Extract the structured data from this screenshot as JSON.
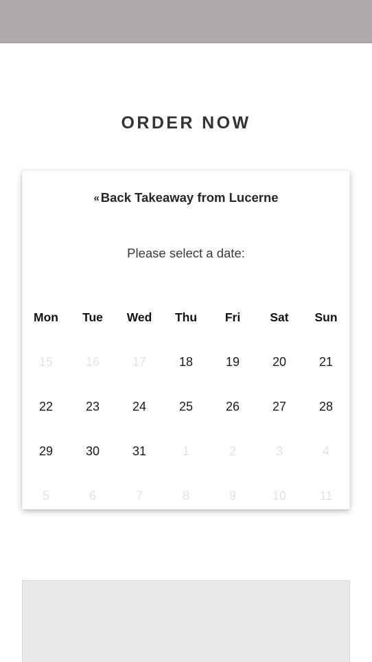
{
  "topbar": {},
  "page": {
    "title": "ORDER NOW"
  },
  "card": {
    "back_chevron": "«",
    "back_label": "Back Takeaway from Lucerne",
    "subtitle": "Please select a date:"
  },
  "calendar": {
    "weekdays": [
      "Mon",
      "Tue",
      "Wed",
      "Thu",
      "Fri",
      "Sat",
      "Sun"
    ],
    "weeks": [
      [
        {
          "day": "15",
          "enabled": false
        },
        {
          "day": "16",
          "enabled": false
        },
        {
          "day": "17",
          "enabled": false
        },
        {
          "day": "18",
          "enabled": true
        },
        {
          "day": "19",
          "enabled": true
        },
        {
          "day": "20",
          "enabled": true
        },
        {
          "day": "21",
          "enabled": true
        }
      ],
      [
        {
          "day": "22",
          "enabled": true
        },
        {
          "day": "23",
          "enabled": true
        },
        {
          "day": "24",
          "enabled": true
        },
        {
          "day": "25",
          "enabled": true
        },
        {
          "day": "26",
          "enabled": true
        },
        {
          "day": "27",
          "enabled": true
        },
        {
          "day": "28",
          "enabled": true
        }
      ],
      [
        {
          "day": "29",
          "enabled": true
        },
        {
          "day": "30",
          "enabled": true
        },
        {
          "day": "31",
          "enabled": true
        },
        {
          "day": "1",
          "enabled": false
        },
        {
          "day": "2",
          "enabled": false
        },
        {
          "day": "3",
          "enabled": false
        },
        {
          "day": "4",
          "enabled": false
        }
      ],
      [
        {
          "day": "5",
          "enabled": false
        },
        {
          "day": "6",
          "enabled": false
        },
        {
          "day": "7",
          "enabled": false
        },
        {
          "day": "8",
          "enabled": false
        },
        {
          "day": "9",
          "enabled": false
        },
        {
          "day": "10",
          "enabled": false
        },
        {
          "day": "11",
          "enabled": false
        }
      ]
    ]
  },
  "colors": {
    "topbar": "#aeaaa9",
    "title_text": "#333333",
    "card_bg": "#ffffff",
    "day_enabled": "#1a1a1a",
    "day_disabled": "#e3e3e3",
    "bottom_panel": "#e9e9e9"
  }
}
